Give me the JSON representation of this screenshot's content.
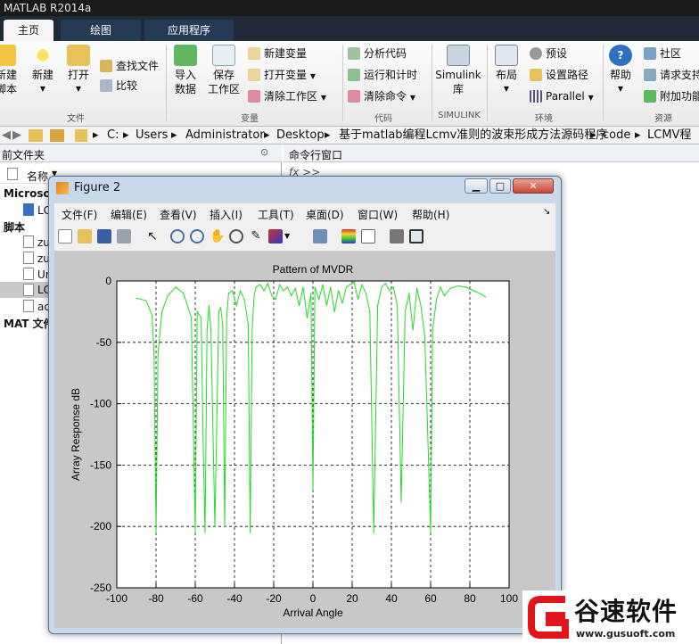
{
  "app_title": "MATLAB R2014a",
  "tabs": [
    "主页",
    "绘图",
    "应用程序"
  ],
  "ribbon": {
    "new_script": "新建\n脚本",
    "new": "新建",
    "open": "打开",
    "find_files": "查找文件",
    "compare": "比较",
    "import_data": "导入\n数据",
    "save_workspace": "保存\n工作区",
    "new_variable": "新建变量",
    "open_variable": "打开变量",
    "clear_workspace": "清除工作区",
    "analyze_code": "分析代码",
    "run_and_time": "运行和计时",
    "clear_commands": "清除命令",
    "simulink": "Simulink\n库",
    "layout": "布局",
    "preferences": "预设",
    "set_path": "设置路径",
    "parallel": "Parallel",
    "help": "帮助",
    "community": "社区",
    "request_support": "请求支持",
    "addons": "附加功能",
    "groups": {
      "file": "文件",
      "variable": "变量",
      "code": "代码",
      "simulink": "SIMULINK",
      "environment": "环境",
      "resources": "资源"
    }
  },
  "address": [
    "C:",
    "Users",
    "Administrator",
    "Desktop",
    "基于matlab编程Lcmv准则的波束形成方法源码程序",
    "code",
    "LCMV程序"
  ],
  "left_panel": {
    "title": "前文件夹",
    "column": "名称",
    "items": [
      "Microso",
      "LC",
      "脚本",
      "zu",
      "zu",
      "Ur",
      "LC",
      "ac",
      "MAT 文件"
    ]
  },
  "cmd_panel": {
    "title": "命令行窗口",
    "fx": "fx >>"
  },
  "figure": {
    "title": "Figure 2",
    "menus": [
      "文件(F)",
      "编辑(E)",
      "查看(V)",
      "插入(I)",
      "工具(T)",
      "桌面(D)",
      "窗口(W)",
      "帮助(H)"
    ]
  },
  "watermark": {
    "brand": "谷速软件",
    "url": "www.gusuoft.com"
  },
  "chart_data": {
    "type": "line",
    "title": "Pattern of MVDR",
    "xlabel": "Arrival Angle",
    "ylabel": "Array Response dB",
    "xlim": [
      -100,
      100
    ],
    "ylim": [
      -250,
      0
    ],
    "xticks": [
      -100,
      -80,
      -60,
      -40,
      -20,
      0,
      20,
      40,
      60,
      80,
      100
    ],
    "yticks": [
      0,
      -50,
      -100,
      -150,
      -200,
      -250
    ],
    "grid": true,
    "series": [
      {
        "color": "#22dd22",
        "x": [
          -90,
          -85,
          -82,
          -81,
          -80,
          -79,
          -77,
          -74,
          -70,
          -66,
          -62,
          -60,
          -59,
          -57,
          -56,
          -55,
          -54,
          -53,
          -52,
          -50,
          -48,
          -47,
          -46,
          -45,
          -44,
          -43,
          -41,
          -39,
          -37,
          -35,
          -33,
          -32,
          -31,
          -30,
          -29,
          -27,
          -25,
          -23,
          -21,
          -19,
          -17,
          -15,
          -13,
          -11,
          -9,
          -7,
          -5,
          -3,
          -1,
          0,
          1,
          3,
          5,
          7,
          9,
          11,
          13,
          15,
          17,
          19,
          21,
          23,
          25,
          27,
          29,
          31,
          33,
          35,
          37,
          39,
          41,
          43,
          45,
          47,
          49,
          51,
          53,
          55,
          57,
          59,
          60,
          61,
          63,
          65,
          67,
          70,
          74,
          78,
          82,
          86,
          88
        ],
        "y": [
          -14,
          -16,
          -28,
          -60,
          -205,
          -60,
          -25,
          -12,
          -5,
          -10,
          -30,
          -205,
          -25,
          -30,
          -130,
          -205,
          -40,
          -20,
          -40,
          -200,
          -25,
          -22,
          -35,
          -200,
          -30,
          -10,
          -8,
          -20,
          -8,
          -15,
          -35,
          -205,
          -40,
          -12,
          -5,
          -3,
          -8,
          -2,
          -12,
          -15,
          -3,
          -8,
          -5,
          -12,
          -6,
          -20,
          -5,
          -30,
          -10,
          -170,
          -5,
          -15,
          -3,
          -20,
          -5,
          -25,
          -8,
          -18,
          -5,
          -3,
          -1,
          -15,
          -3,
          -10,
          -25,
          -205,
          -20,
          -5,
          -2,
          -8,
          -5,
          -20,
          -180,
          -25,
          -10,
          -40,
          -6,
          -20,
          -45,
          -150,
          -205,
          -40,
          -15,
          -5,
          -12,
          -6,
          -4,
          -5,
          -8,
          -11,
          -13
        ]
      }
    ]
  }
}
